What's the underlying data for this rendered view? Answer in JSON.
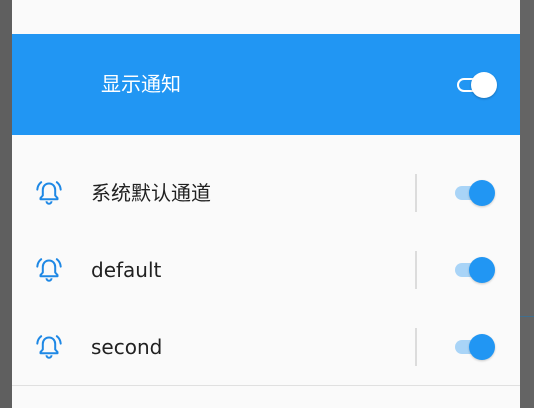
{
  "header": {
    "title": "显示通知",
    "toggle_on": true,
    "background_color": "#2196f3"
  },
  "channels": [
    {
      "name": "系统默认通道",
      "icon": "ringing-bell-icon",
      "enabled": true
    },
    {
      "name": "default",
      "icon": "ringing-bell-icon",
      "enabled": true
    },
    {
      "name": "second",
      "icon": "ringing-bell-icon",
      "enabled": true
    }
  ],
  "colors": {
    "accent": "#2196f3",
    "icon": "#1e88e5",
    "text": "#212121"
  }
}
